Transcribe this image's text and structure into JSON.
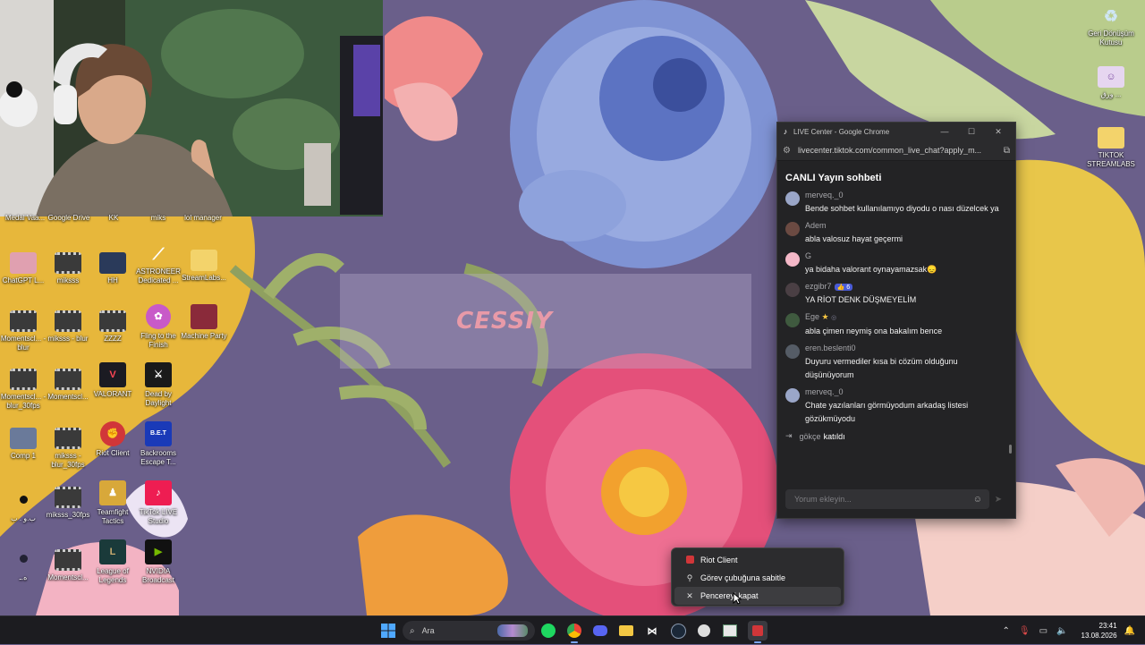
{
  "wallpaper": {
    "banner_text": "CESSIY"
  },
  "desktop_icons_right": [
    {
      "label": "Geri Dönüşüm Kutusu",
      "icon": "recycle-bin-icon"
    },
    {
      "label": "ورق ...",
      "icon": "app-icon"
    },
    {
      "label": "TIKTOK STREAMLABS",
      "icon": "folder-icon"
    }
  ],
  "desktop_icons_top_row": [
    "Medal Vaa...",
    "Google Drive",
    "KK",
    "miks",
    "lol manager"
  ],
  "desktop_icons": [
    {
      "label": "ChatGPT L...",
      "icon": "image-icon"
    },
    {
      "label": "miksss",
      "icon": "video-icon"
    },
    {
      "label": "HH",
      "icon": "image-icon"
    },
    {
      "label": "ASTRONEER Dedicated ...",
      "icon": "game-icon"
    },
    {
      "label": "StreamLabs...",
      "icon": "folder-icon"
    },
    {
      "label": "Momentscl... - blur",
      "icon": "video-icon"
    },
    {
      "label": "miksss - blur",
      "icon": "video-icon"
    },
    {
      "label": "ZZZZ",
      "icon": "video-icon"
    },
    {
      "label": "Fling to the Finish",
      "icon": "game-icon"
    },
    {
      "label": "Machine Party",
      "icon": "game-icon"
    },
    {
      "label": "Momentscl... - blur_30fps",
      "icon": "video-icon"
    },
    {
      "label": "Momentscl...",
      "icon": "video-icon"
    },
    {
      "label": "VALORANT",
      "icon": "valorant-icon"
    },
    {
      "label": "Dead by Daylight",
      "icon": "game-icon"
    },
    {
      "label": "Comp 1",
      "icon": "image-icon"
    },
    {
      "label": "miksss - blur_30fps",
      "icon": "video-icon"
    },
    {
      "label": "Riot Client",
      "icon": "riot-icon"
    },
    {
      "label": "Backrooms Escape T...",
      "icon": "game-icon"
    },
    {
      "label": "ب.و . ب",
      "icon": "dot-icon"
    },
    {
      "label": "miksss_30fps",
      "icon": "video-icon"
    },
    {
      "label": "Teamfight Tactics",
      "icon": "game-icon"
    },
    {
      "label": "TikTok LIVE Studio",
      "icon": "tiktok-icon"
    },
    {
      "label": "ه.ـ",
      "icon": "dot-icon"
    },
    {
      "label": "Momentscl...",
      "icon": "video-icon"
    },
    {
      "label": "League of Legends",
      "icon": "game-icon"
    },
    {
      "label": "NVIDIA Broadcast",
      "icon": "nvidia-icon"
    }
  ],
  "chat_window": {
    "title": "LIVE Center - Google Chrome",
    "url": "livecenter.tiktok.com/common_live_chat?apply_m...",
    "heading": "CANLI Yayın sohbeti",
    "messages": [
      {
        "user": "merveq._0",
        "text": "Bende sohbet kullanılamıyo diyodu o nası düzelcek ya",
        "avatar_color": "#9aa6c8"
      },
      {
        "user": "Adem",
        "text": "abla valosuz hayat geçermi",
        "avatar_color": "#6b4a42"
      },
      {
        "user": "G",
        "text": "ya bidaha valorant oynayamazsak😞",
        "avatar_color": "#f4b8c8"
      },
      {
        "user": "ezgibr7",
        "badge": "6",
        "text": "YA RİOT DENK DÜŞMEYELİM",
        "avatar_color": "#4a3f44"
      },
      {
        "user": "Ege",
        "text": "abla çimen neymiş ona bakalım bence",
        "avatar_color": "#3f5a3f"
      },
      {
        "user": "eren.beslenti0",
        "text": "Duyuru vermediler kısa bi cözüm olduğunu düşünüyorum",
        "avatar_color": "#555c66"
      },
      {
        "user": "merveq._0",
        "text": "Chate yazılanları görmüyodum arkadaş listesi gözükmüyodu",
        "avatar_color": "#9aa6c8"
      }
    ],
    "join": {
      "user": "gökçe",
      "text": "katıldı"
    },
    "input_placeholder": "Yorum ekleyin..."
  },
  "context_menu": {
    "items": [
      {
        "label": "Riot Client",
        "icon": "riot-icon"
      },
      {
        "label": "Görev çubuğuna sabitle",
        "icon": "pin-icon"
      },
      {
        "label": "Pencereyi kapat",
        "icon": "close-icon"
      }
    ]
  },
  "taskbar": {
    "search_label": "Ara",
    "time": "23:41",
    "date": "13.08.2026"
  }
}
